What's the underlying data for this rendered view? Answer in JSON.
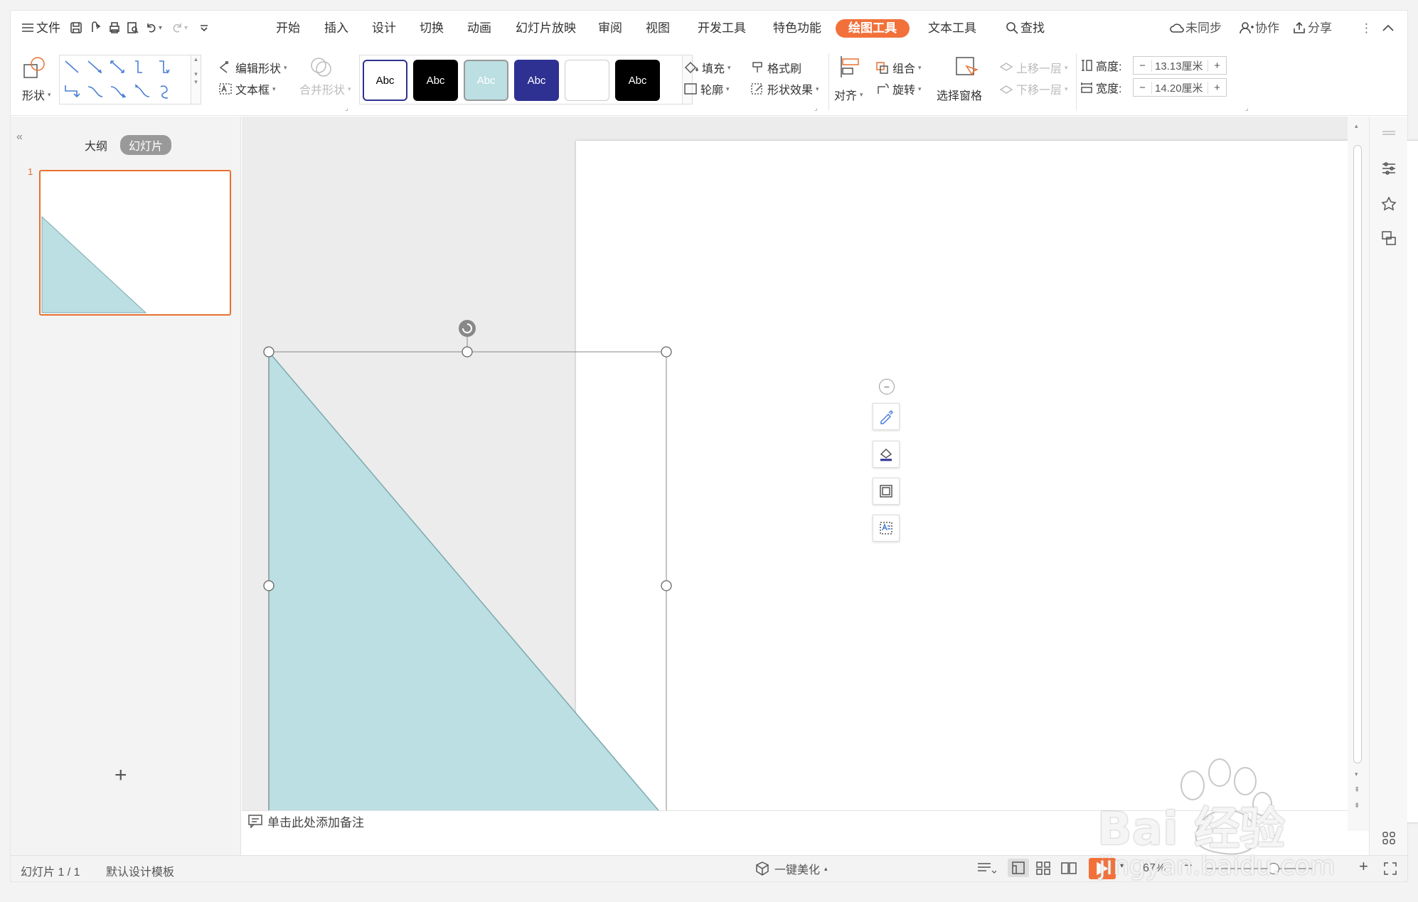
{
  "menubar": {
    "file": "文件",
    "tabs": [
      "开始",
      "插入",
      "设计",
      "切换",
      "动画",
      "幻灯片放映",
      "审阅",
      "视图",
      "开发工具",
      "特色功能",
      "绘图工具",
      "文本工具"
    ],
    "active_tab": "绘图工具",
    "search": "查找",
    "sync": "未同步",
    "collab": "协作",
    "share": "分享"
  },
  "ribbon": {
    "shape": "形状",
    "edit_shape": "编辑形状",
    "textbox": "文本框",
    "merge_shape": "合并形状",
    "style_label": "Abc",
    "fill": "填充",
    "format_painter": "格式刷",
    "outline": "轮廓",
    "shape_effect": "形状效果",
    "align": "对齐",
    "group": "组合",
    "rotate": "旋转",
    "select_pane": "选择窗格",
    "bring_forward": "上移一层",
    "send_backward": "下移一层",
    "height_label": "高度:",
    "height_value": "13.13厘米",
    "width_label": "宽度:",
    "width_value": "14.20厘米",
    "minus": "−",
    "plus": "+"
  },
  "leftpanel": {
    "outline_tab": "大纲",
    "slides_tab": "幻灯片",
    "slide_number": "1",
    "add": "+"
  },
  "notes": {
    "placeholder": "单击此处添加备注"
  },
  "statusbar": {
    "slide_info": "幻灯片 1 / 1",
    "template": "默认设计模板",
    "beautify": "一键美化",
    "zoom": "67%"
  },
  "watermark": {
    "brand": "Bai 经验",
    "url": "jingyan.baidu.com"
  },
  "colors": {
    "accent": "#f2713b",
    "shape_fill": "#bbdfe2",
    "shape_stroke": "#7ea9ad",
    "style_dark_blue": "#2e3192"
  }
}
